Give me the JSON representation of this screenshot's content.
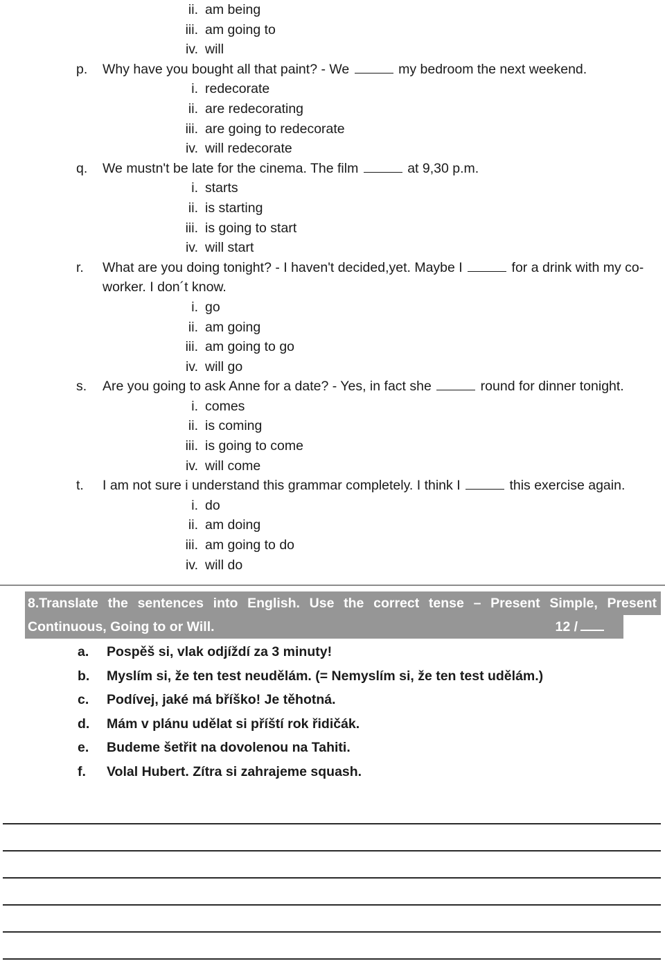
{
  "mc_questions": [
    {
      "type": "options_only",
      "options": [
        {
          "marker": "ii.",
          "text": "am being"
        },
        {
          "marker": "iii.",
          "text": "am going to"
        },
        {
          "marker": "iv.",
          "text": "will"
        }
      ]
    },
    {
      "type": "question",
      "marker": "p.",
      "text_before": "Why have you bought all that paint? - We",
      "text_after": "my bedroom the next weekend.",
      "justify": false,
      "options": [
        {
          "marker": "i.",
          "text": "redecorate"
        },
        {
          "marker": "ii.",
          "text": "are redecorating"
        },
        {
          "marker": "iii.",
          "text": "are going to redecorate"
        },
        {
          "marker": "iv.",
          "text": "will redecorate"
        }
      ]
    },
    {
      "type": "question",
      "marker": "q.",
      "text_before": "We mustn't be late for the cinema. The film",
      "text_after": "at 9,30 p.m.",
      "justify": false,
      "options": [
        {
          "marker": "i.",
          "text": "starts"
        },
        {
          "marker": "ii.",
          "text": "is starting"
        },
        {
          "marker": "iii.",
          "text": "is going to start"
        },
        {
          "marker": "iv.",
          "text": "will start"
        }
      ]
    },
    {
      "type": "question",
      "marker": "r.",
      "text_before": "What are you doing tonight? - I haven't decided,yet. Maybe I",
      "text_after": "for a drink with my co-worker. I don´t know.",
      "justify": false,
      "options": [
        {
          "marker": "i.",
          "text": "go"
        },
        {
          "marker": "ii.",
          "text": "am going"
        },
        {
          "marker": "iii.",
          "text": "am going to go"
        },
        {
          "marker": "iv.",
          "text": "will go"
        }
      ]
    },
    {
      "type": "question",
      "marker": "s.",
      "text_before": "Are you going to ask Anne for a date? - Yes, in fact she",
      "text_after": "round for dinner tonight.",
      "justify": true,
      "options": [
        {
          "marker": "i.",
          "text": "comes"
        },
        {
          "marker": "ii.",
          "text": "is coming"
        },
        {
          "marker": "iii.",
          "text": "is going to come"
        },
        {
          "marker": "iv.",
          "text": "will come"
        }
      ]
    },
    {
      "type": "question",
      "marker": "t.",
      "text_before": "I am not sure i understand this grammar completely. I think I",
      "text_after": "this exercise again.",
      "justify": true,
      "options": [
        {
          "marker": "i.",
          "text": "do"
        },
        {
          "marker": "ii.",
          "text": "am doing"
        },
        {
          "marker": "iii.",
          "text": "am going to do"
        },
        {
          "marker": "iv.",
          "text": "will do"
        }
      ]
    }
  ],
  "section8": {
    "number": "8.",
    "heading_line1": "Translate the sentences into English. Use the correct tense – Present Simple, Present",
    "heading_line2": "Continuous, Going to or Will.",
    "score": "12 /",
    "highlight_color": "#969696",
    "sentences": [
      {
        "marker": "a.",
        "text": "Pospěš si, vlak odjíždí za 3 minuty!"
      },
      {
        "marker": "b.",
        "text": "Myslím si, že ten test neudělám. (= Nemyslím si, že ten test udělám.)"
      },
      {
        "marker": "c.",
        "text": "Podívej, jaké má bříško! Je těhotná."
      },
      {
        "marker": "d.",
        "text": "Mám v plánu udělat si příští rok řidičák."
      },
      {
        "marker": "e.",
        "text": "Budeme šetřit na dovolenou na Tahiti."
      },
      {
        "marker": "f.",
        "text": "Volal Hubert. Zítra si zahrajeme squash."
      }
    ]
  },
  "answer_lines_count": 6
}
